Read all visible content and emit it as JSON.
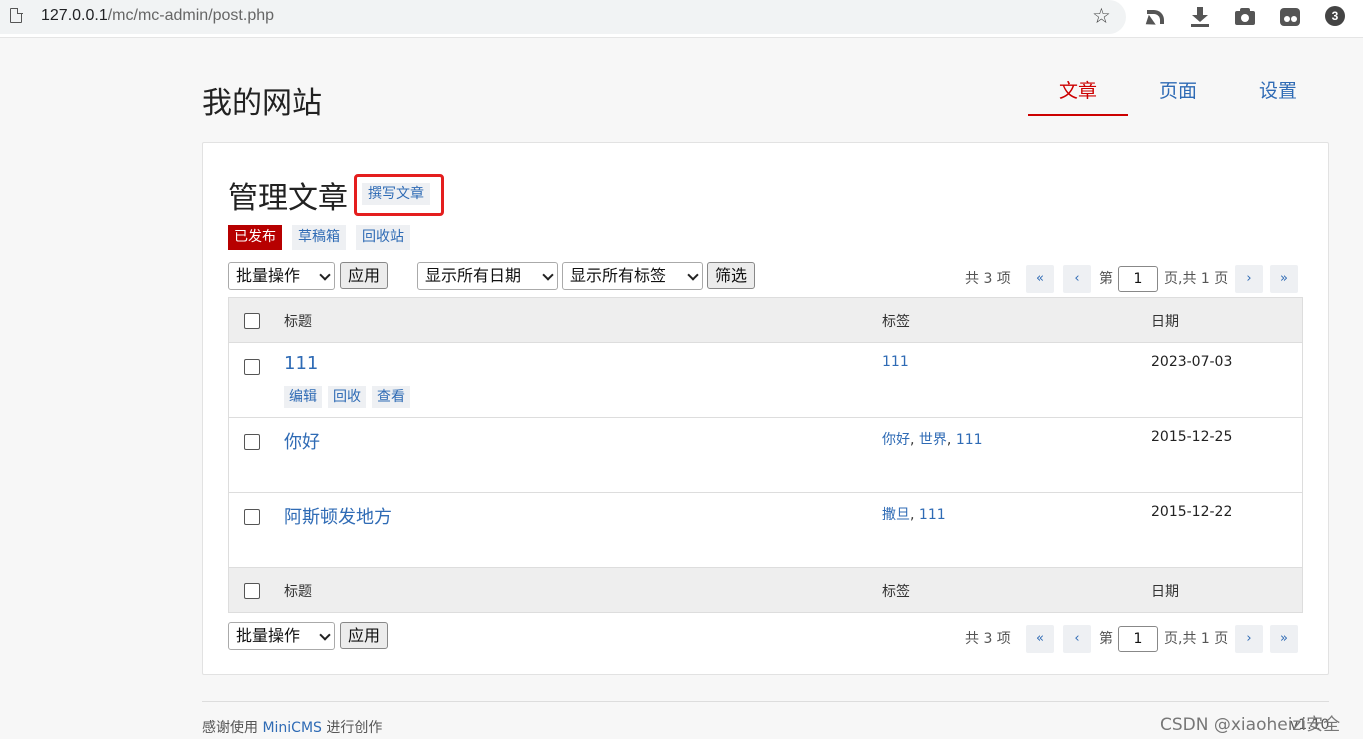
{
  "browser": {
    "url_host": "127.0.0.1",
    "url_path": "/mc/mc-admin/post.php",
    "badge_count": "3"
  },
  "site": {
    "title": "我的网站",
    "nav": [
      {
        "label": "文章",
        "active": true
      },
      {
        "label": "页面",
        "active": false
      },
      {
        "label": "设置",
        "active": false
      }
    ]
  },
  "main": {
    "title": "管理文章",
    "write_button": "撰写文章",
    "filters": [
      "已发布",
      "草稿箱",
      "回收站"
    ],
    "bulk_action": "批量操作",
    "apply": "应用",
    "date_filter": "显示所有日期",
    "tag_filter": "显示所有标签",
    "filter_btn": "筛选",
    "pager": {
      "total": "共 3 项",
      "first": "«",
      "prev": "‹",
      "page_prefix": "第",
      "page": "1",
      "page_suffix": "页,共 1 页",
      "next": "›",
      "last": "»"
    },
    "columns": [
      "标题",
      "标签",
      "日期"
    ],
    "row_actions": [
      "编辑",
      "回收",
      "查看"
    ],
    "posts": [
      {
        "title": "111",
        "tags": [
          "111"
        ],
        "date": "2023-07-03"
      },
      {
        "title": "你好",
        "tags": [
          "你好",
          "世界",
          "111"
        ],
        "date": "2015-12-25"
      },
      {
        "title": "阿斯顿发地方",
        "tags": [
          "撒旦",
          "111"
        ],
        "date": "2015-12-22"
      }
    ]
  },
  "footer": {
    "prefix": "感谢使用",
    "link": "MiniCMS",
    "suffix": "进行创作",
    "version": "v1.10"
  },
  "watermark": "CSDN @xiaoheizi安全",
  "colors": {
    "accent_red": "#c00000",
    "link_blue": "#2f6bb5",
    "highlight_border": "#e41e1e"
  }
}
